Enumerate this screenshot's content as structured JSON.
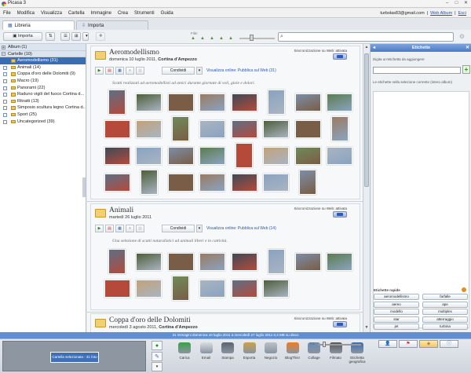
{
  "app": {
    "title": "Picasa 3"
  },
  "menu": [
    "File",
    "Modifica",
    "Visualizza",
    "Cartella",
    "Immagine",
    "Crea",
    "Strumenti",
    "Guida"
  ],
  "user": {
    "email": "turbolas83@gmail.com",
    "sep1": "|",
    "web_album": "Web Album",
    "sep2": "|",
    "exit": "Esci"
  },
  "tabs": {
    "library": "Libreria",
    "import": "Importa"
  },
  "toolbar": {
    "import": "Importa",
    "filter_label": "Filtri"
  },
  "tree": {
    "albums": "Album (1)",
    "folders": "Cartelle (10)",
    "items": [
      {
        "label": "Aeromodellismo (31)",
        "selected": true
      },
      {
        "label": "Animali (14)"
      },
      {
        "label": "Coppa d'oro delle Dolomiti (9)"
      },
      {
        "label": "Macro (19)"
      },
      {
        "label": "Panorami (22)"
      },
      {
        "label": "Raduno vigili del fuoco Cortina d..."
      },
      {
        "label": "Ritratti (13)"
      },
      {
        "label": "Simposio scultura legno Cortina d..."
      },
      {
        "label": "Sport (25)"
      },
      {
        "label": "Uncategorized (39)"
      }
    ]
  },
  "albums": [
    {
      "title": "Aeromodellismo",
      "date_prefix": "domenica 10 luglio 2011,",
      "place": "Cortina d'Ampezzo",
      "caption": "Scatti realizzati ad aeromodellisti ad amici durante giornate di voli, gioie e dolori.",
      "sync": "Sincronizzazione su Web: attivata",
      "view_online": "Visualizza online: Pubblica sul Web (31)",
      "share": "Condividi"
    },
    {
      "title": "Animali",
      "date_prefix": "martedì 26 luglio 2011",
      "place": "",
      "caption": "Una selezione di scatti naturalistici ad animali liberi e in cattività.",
      "sync": "Sincronizzazione su Web: attivata",
      "view_online": "Visualizza online: Pubblica sul Web (14)",
      "share": "Condividi"
    },
    {
      "title": "Coppa d'oro delle Dolomiti",
      "date_prefix": "mercoledì 3 agosto 2011,",
      "place": "Cortina d'Ampezzo",
      "caption": "",
      "sync": "Sincronizzazione su Web: attivata",
      "view_online": "",
      "share": ""
    }
  ],
  "right_panel": {
    "title": "Etichette",
    "new_tag_label": "Digita un'etichetta da aggiungere",
    "current_tags_label": "Le etichette nella selezione corrente (intero album)",
    "quick_label": "Etichette rapide",
    "quick_tags": [
      "aeromodellismo",
      "farfalle",
      "aereo",
      "ape",
      "modello",
      "multiplex",
      "star",
      "atterraggio",
      "jet",
      "turbina"
    ]
  },
  "statusline": "31 immagini    domenica 10 luglio 2011 a mercoledì 27 luglio 2011    0,4 MB su disco",
  "tray": {
    "selection_label": "Cartella selezionata - 31 foto"
  },
  "actions": [
    "Carica",
    "Email",
    "Stampa",
    "Esporta",
    "Negozio",
    "BlogThis!",
    "Collage",
    "Filmato",
    "Etichetta geografica"
  ]
}
